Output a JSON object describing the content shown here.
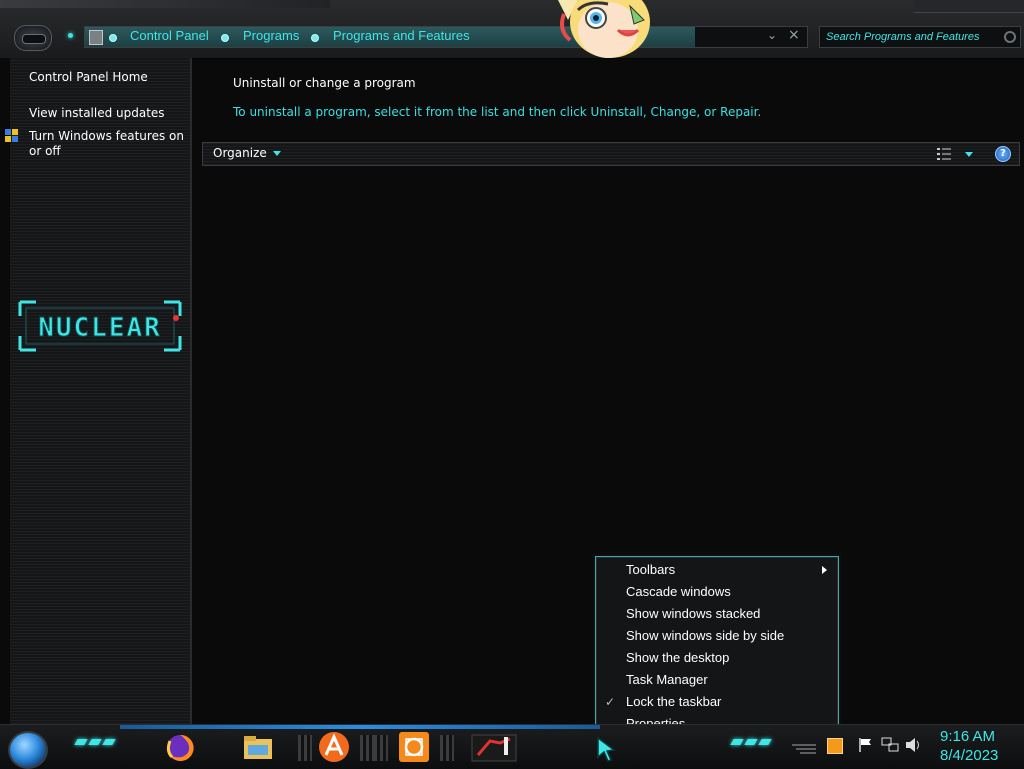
{
  "window": {
    "breadcrumbs": [
      "Control Panel",
      "Programs",
      "Programs and Features"
    ],
    "search_placeholder": "Search Programs and Features"
  },
  "sidebar": {
    "items": [
      {
        "label": "Control Panel Home"
      },
      {
        "label": "View installed updates"
      },
      {
        "label": "Turn Windows features on or off"
      }
    ],
    "logo_text": "NUCLEAR"
  },
  "main": {
    "title": "Uninstall or change a program",
    "description": "To uninstall a program, select it from the list and then click Uninstall, Change, or Repair.",
    "toolbar": {
      "organize_label": "Organize",
      "help_label": "?"
    }
  },
  "context_menu": {
    "items": [
      {
        "label": "Toolbars",
        "submenu": true
      },
      {
        "label": "Cascade windows"
      },
      {
        "label": "Show windows stacked"
      },
      {
        "label": "Show windows side by side"
      },
      {
        "label": "Show the desktop"
      },
      {
        "label": "Task Manager"
      },
      {
        "label": "Lock the taskbar",
        "checked": true
      },
      {
        "label": "Properties"
      }
    ]
  },
  "taskbar": {
    "apps": [
      "firefox-icon",
      "file-explorer-icon",
      "avast-icon",
      "settings-app-icon",
      "game-app-icon"
    ],
    "clock": {
      "time": "9:16 AM",
      "date": "8/4/2023"
    }
  },
  "theme": {
    "accent": "#3ee6e6",
    "background": "#0a0a0b"
  }
}
